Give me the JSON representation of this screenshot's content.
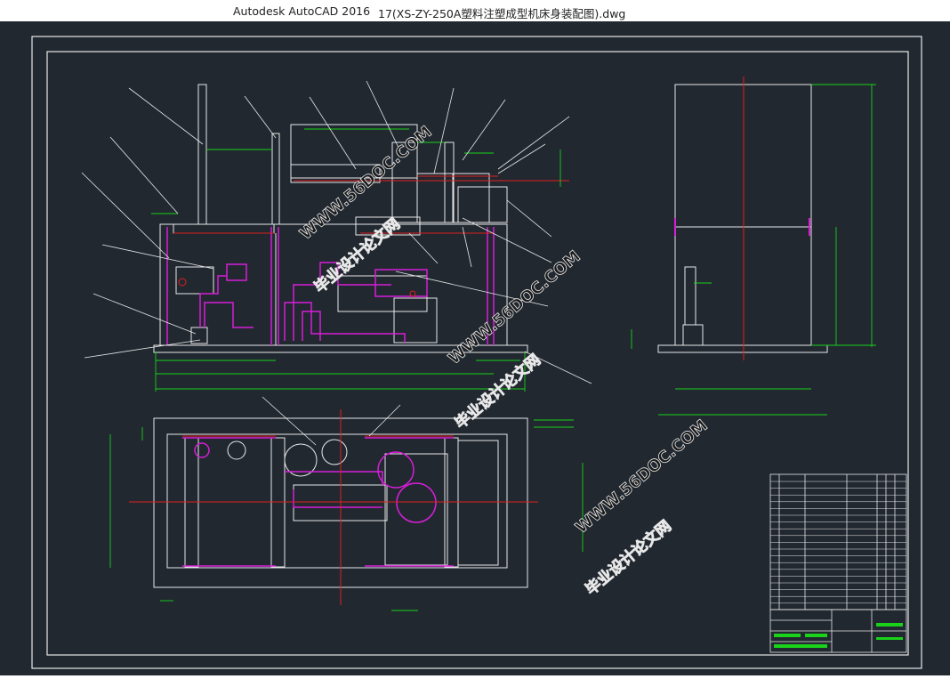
{
  "window": {
    "app_name": "Autodesk AutoCAD 2016",
    "file_name": "17(XS-ZY-250A塑料注塑成型机床身装配图).dwg"
  },
  "watermarks": [
    {
      "site": "WWW.56DOC.COM",
      "label": "毕业设计论文网"
    },
    {
      "site": "WWW.56DOC.COM",
      "label": "毕业设计论文网"
    },
    {
      "site": "WWW.56DOC.COM",
      "label": "毕业设计论文网"
    }
  ],
  "colors": {
    "canvas_bg": "#212830",
    "line_white": "#e8e8e8",
    "dimension_green": "#19d219",
    "highlight_magenta": "#d81ed8",
    "centerline_red": "#e02020",
    "watermark_text": "#e8e8e8"
  }
}
